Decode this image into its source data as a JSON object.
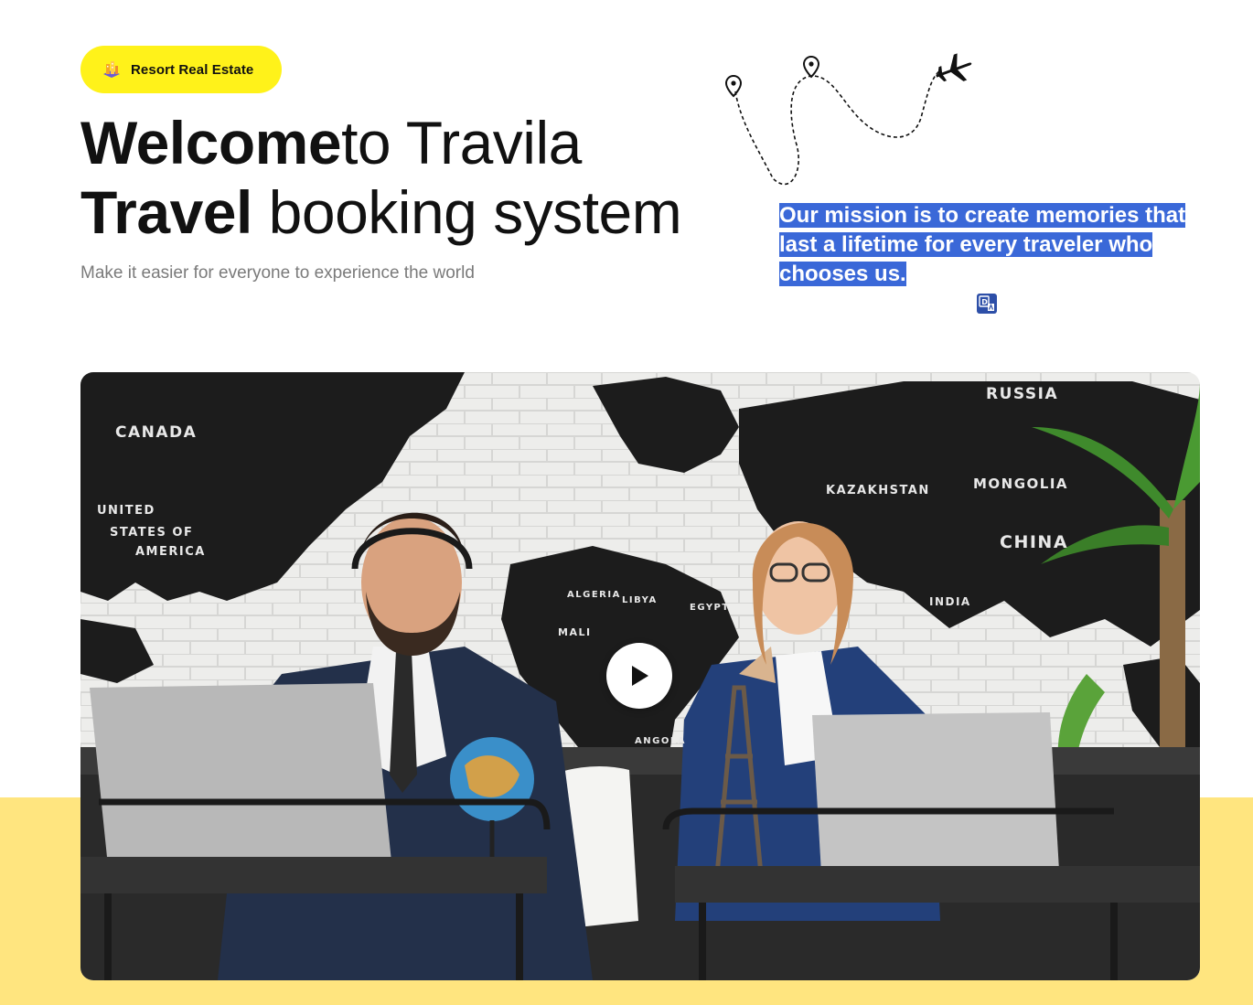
{
  "badge": {
    "label": "Resort Real Estate",
    "icon": "building-icon"
  },
  "hero": {
    "title_bold_1": "Welcome",
    "title_rest_1": "to Travila",
    "title_bold_2": "Travel",
    "title_rest_2": " booking system",
    "subtitle": "Make it easier for everyone to experience the world"
  },
  "mission": {
    "text": "Our mission is to create memories that last a lifetime for every traveler who chooses us.",
    "translate_icon": "translate-icon"
  },
  "video": {
    "play_icon": "play-icon",
    "map_labels": {
      "canada": "CANADA",
      "usa_1": "UNITED",
      "usa_2": "STATES OF",
      "usa_3": "AMERICA",
      "russia": "RUSSIA",
      "kazakhstan": "KAZAKHSTAN",
      "mongolia": "MONGOLIA",
      "china": "CHINA",
      "india": "INDIA",
      "algeria": "ALGERIA",
      "libya": "LIBYA",
      "egypt": "EGYPT",
      "mali": "MALI",
      "angola": "ANGOLA"
    }
  },
  "colors": {
    "badge_bg": "#FFF21A",
    "band_bg": "#FFE57F",
    "highlight": "#3A68D8",
    "subtitle": "#7a7a7a"
  }
}
